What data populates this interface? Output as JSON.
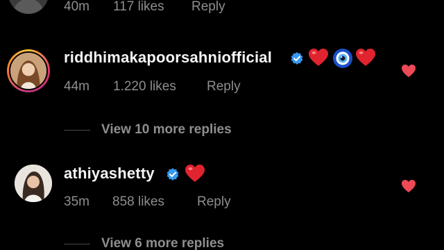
{
  "top_comment": {
    "time": "40m",
    "likes": "117 likes",
    "reply_label": "Reply"
  },
  "comments": [
    {
      "username": "riddhimakapoorsahniofficial",
      "verified": true,
      "emojis": [
        "red-heart",
        "nazar-amulet",
        "red-heart"
      ],
      "time": "44m",
      "likes": "1.220 likes",
      "reply_label": "Reply",
      "liked": true,
      "view_replies": "View 10 more replies"
    },
    {
      "username": "athiyashetty",
      "verified": true,
      "emojis": [
        "red-heart"
      ],
      "time": "35m",
      "likes": "858 likes",
      "reply_label": "Reply",
      "liked": true,
      "view_replies": "View 6 more replies"
    }
  ],
  "colors": {
    "background": "#000000",
    "text_primary": "#f5f5f5",
    "text_secondary": "#8e8e8e",
    "verified_blue": "#3897f0",
    "like_red": "#ed4956"
  }
}
